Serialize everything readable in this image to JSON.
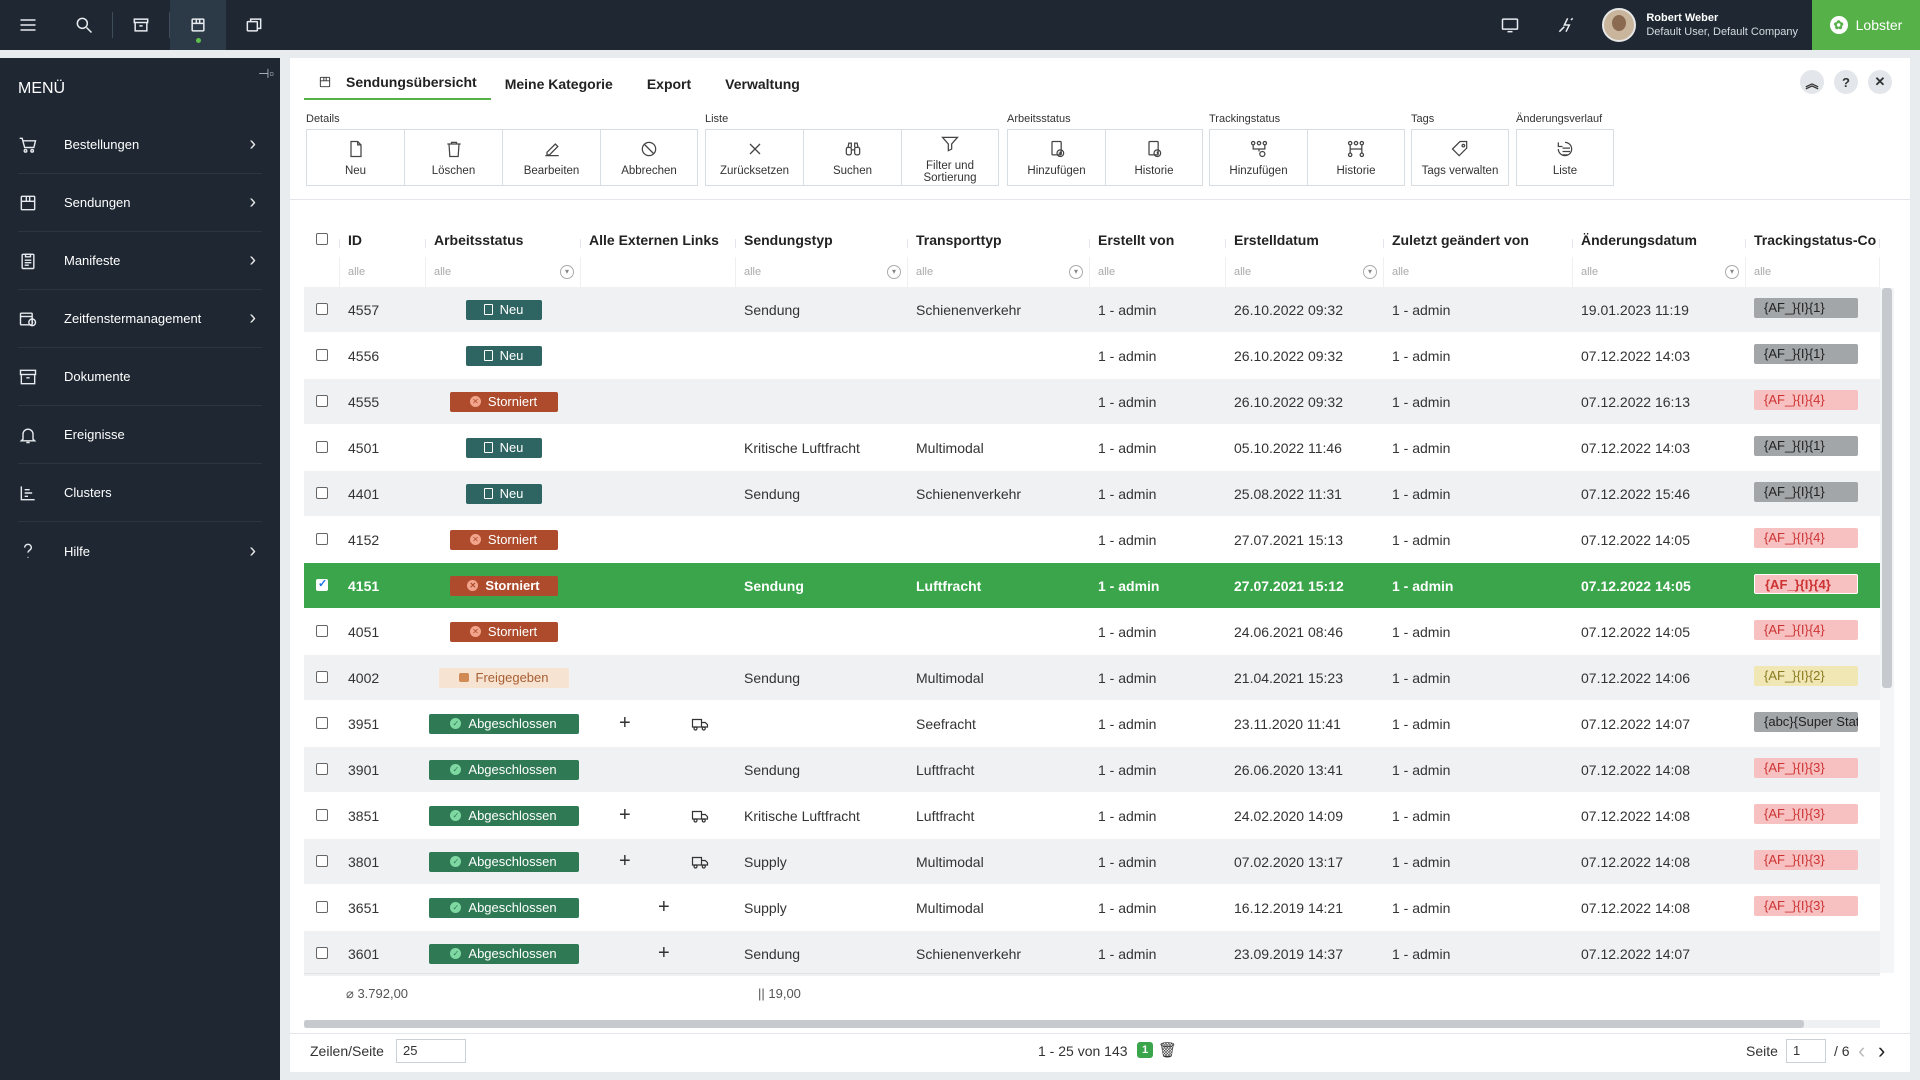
{
  "topbar": {
    "user_name": "Robert Weber",
    "user_sub": "Default User, Default Company",
    "brand": "Lobster"
  },
  "sidebar": {
    "title": "MENÜ",
    "items": [
      {
        "label": "Bestellungen",
        "icon": "cart-icon",
        "has_sub": true
      },
      {
        "label": "Sendungen",
        "icon": "package-icon",
        "has_sub": true
      },
      {
        "label": "Manifeste",
        "icon": "clipboard-icon",
        "has_sub": true
      },
      {
        "label": "Zeitfenstermanagement",
        "icon": "calendar-clock-icon",
        "has_sub": true
      },
      {
        "label": "Dokumente",
        "icon": "archive-icon",
        "has_sub": false
      },
      {
        "label": "Ereignisse",
        "icon": "bell-icon",
        "has_sub": false
      },
      {
        "label": "Clusters",
        "icon": "bars-icon",
        "has_sub": false
      },
      {
        "label": "Hilfe",
        "icon": "question-icon",
        "has_sub": true
      }
    ]
  },
  "tabs": [
    "Sendungsübersicht",
    "Meine Kategorie",
    "Export",
    "Verwaltung"
  ],
  "toolbar": {
    "details": {
      "label": "Details",
      "buttons": [
        "Neu",
        "Löschen",
        "Bearbeiten",
        "Abbrechen"
      ]
    },
    "liste": {
      "label": "Liste",
      "buttons": [
        "Zurücksetzen",
        "Suchen",
        "Filter und Sortierung"
      ]
    },
    "arbeitsstatus": {
      "label": "Arbeitsstatus",
      "buttons": [
        "Hinzufügen",
        "Historie"
      ]
    },
    "trackingstatus": {
      "label": "Trackingstatus",
      "buttons": [
        "Hinzufügen",
        "Historie"
      ]
    },
    "tags": {
      "label": "Tags",
      "buttons": [
        "Tags verwalten"
      ]
    },
    "aenderungsverlauf": {
      "label": "Änderungsverlauf",
      "buttons": [
        "Liste"
      ]
    }
  },
  "table": {
    "columns": [
      "ID",
      "Arbeitsstatus",
      "Alle Externen Links",
      "Sendungstyp",
      "Transporttyp",
      "Erstellt von",
      "Erstelldatum",
      "Zuletzt geändert von",
      "Änderungsdatum",
      "Trackingstatus-Co"
    ],
    "filter_placeholder": "alle",
    "rows": [
      {
        "id": "4557",
        "status": "Neu",
        "status_kind": "neu",
        "links": "",
        "sendungstyp": "Sendung",
        "transporttyp": "Schienenverkehr",
        "erstellt_von": "1 - admin",
        "erstelldatum": "26.10.2022 09:32",
        "geaendert_von": "1 - admin",
        "aenderungsdatum": "19.01.2023 11:19",
        "tracking": "{AF_}{I}{1}",
        "tracking_kind": "grey",
        "selected": false
      },
      {
        "id": "4556",
        "status": "Neu",
        "status_kind": "neu",
        "links": "",
        "sendungstyp": "",
        "transporttyp": "",
        "erstellt_von": "1 - admin",
        "erstelldatum": "26.10.2022 09:32",
        "geaendert_von": "1 - admin",
        "aenderungsdatum": "07.12.2022 14:03",
        "tracking": "{AF_}{I}{1}",
        "tracking_kind": "grey",
        "selected": false
      },
      {
        "id": "4555",
        "status": "Storniert",
        "status_kind": "sto",
        "links": "",
        "sendungstyp": "",
        "transporttyp": "",
        "erstellt_von": "1 - admin",
        "erstelldatum": "26.10.2022 09:32",
        "geaendert_von": "1 - admin",
        "aenderungsdatum": "07.12.2022 16:13",
        "tracking": "{AF_}{I}{4}",
        "tracking_kind": "red",
        "selected": false
      },
      {
        "id": "4501",
        "status": "Neu",
        "status_kind": "neu",
        "links": "",
        "sendungstyp": "Kritische Luftfracht",
        "transporttyp": "Multimodal",
        "erstellt_von": "1 - admin",
        "erstelldatum": "05.10.2022 11:46",
        "geaendert_von": "1 - admin",
        "aenderungsdatum": "07.12.2022 14:03",
        "tracking": "{AF_}{I}{1}",
        "tracking_kind": "grey",
        "selected": false
      },
      {
        "id": "4401",
        "status": "Neu",
        "status_kind": "neu",
        "links": "",
        "sendungstyp": "Sendung",
        "transporttyp": "Schienenverkehr",
        "erstellt_von": "1 - admin",
        "erstelldatum": "25.08.2022 11:31",
        "geaendert_von": "1 - admin",
        "aenderungsdatum": "07.12.2022 15:46",
        "tracking": "{AF_}{I}{1}",
        "tracking_kind": "grey",
        "selected": false
      },
      {
        "id": "4152",
        "status": "Storniert",
        "status_kind": "sto",
        "links": "",
        "sendungstyp": "",
        "transporttyp": "",
        "erstellt_von": "1 - admin",
        "erstelldatum": "27.07.2021 15:13",
        "geaendert_von": "1 - admin",
        "aenderungsdatum": "07.12.2022 14:05",
        "tracking": "{AF_}{I}{4}",
        "tracking_kind": "red",
        "selected": false
      },
      {
        "id": "4151",
        "status": "Storniert",
        "status_kind": "sto",
        "links": "",
        "sendungstyp": "Sendung",
        "transporttyp": "Luftfracht",
        "erstellt_von": "1 - admin",
        "erstelldatum": "27.07.2021 15:12",
        "geaendert_von": "1 - admin",
        "aenderungsdatum": "07.12.2022 14:05",
        "tracking": "{AF_}{I}{4}",
        "tracking_kind": "red",
        "selected": true
      },
      {
        "id": "4051",
        "status": "Storniert",
        "status_kind": "sto",
        "links": "",
        "sendungstyp": "",
        "transporttyp": "",
        "erstellt_von": "1 - admin",
        "erstelldatum": "24.06.2021 08:46",
        "geaendert_von": "1 - admin",
        "aenderungsdatum": "07.12.2022 14:05",
        "tracking": "{AF_}{I}{4}",
        "tracking_kind": "red",
        "selected": false
      },
      {
        "id": "4002",
        "status": "Freigegeben",
        "status_kind": "fre",
        "links": "",
        "sendungstyp": "Sendung",
        "transporttyp": "Multimodal",
        "erstellt_von": "1 - admin",
        "erstelldatum": "21.04.2021 15:23",
        "geaendert_von": "1 - admin",
        "aenderungsdatum": "07.12.2022 14:06",
        "tracking": "{AF_}{I}{2}",
        "tracking_kind": "yel",
        "selected": false
      },
      {
        "id": "3951",
        "status": "Abgeschlossen",
        "status_kind": "abg",
        "links": "plus-truck",
        "sendungstyp": "",
        "transporttyp": "Seefracht",
        "erstellt_von": "1 - admin",
        "erstelldatum": "23.11.2020 11:41",
        "geaendert_von": "1 - admin",
        "aenderungsdatum": "07.12.2022 14:07",
        "tracking": "{abc}{Super Status}",
        "tracking_kind": "grey",
        "selected": false
      },
      {
        "id": "3901",
        "status": "Abgeschlossen",
        "status_kind": "abg",
        "links": "",
        "sendungstyp": "Sendung",
        "transporttyp": "Luftfracht",
        "erstellt_von": "1 - admin",
        "erstelldatum": "26.06.2020 13:41",
        "geaendert_von": "1 - admin",
        "aenderungsdatum": "07.12.2022 14:08",
        "tracking": "{AF_}{I}{3}",
        "tracking_kind": "red",
        "selected": false
      },
      {
        "id": "3851",
        "status": "Abgeschlossen",
        "status_kind": "abg",
        "links": "plus-truck",
        "sendungstyp": "Kritische Luftfracht",
        "transporttyp": "Luftfracht",
        "erstellt_von": "1 - admin",
        "erstelldatum": "24.02.2020 14:09",
        "geaendert_von": "1 - admin",
        "aenderungsdatum": "07.12.2022 14:08",
        "tracking": "{AF_}{I}{3}",
        "tracking_kind": "red",
        "selected": false
      },
      {
        "id": "3801",
        "status": "Abgeschlossen",
        "status_kind": "abg",
        "links": "plus-truck",
        "sendungstyp": "Supply",
        "transporttyp": "Multimodal",
        "erstellt_von": "1 - admin",
        "erstelldatum": "07.02.2020 13:17",
        "geaendert_von": "1 - admin",
        "aenderungsdatum": "07.12.2022 14:08",
        "tracking": "{AF_}{I}{3}",
        "tracking_kind": "red",
        "selected": false
      },
      {
        "id": "3651",
        "status": "Abgeschlossen",
        "status_kind": "abg",
        "links": "plus",
        "sendungstyp": "Supply",
        "transporttyp": "Multimodal",
        "erstellt_von": "1 - admin",
        "erstelldatum": "16.12.2019 14:21",
        "geaendert_von": "1 - admin",
        "aenderungsdatum": "07.12.2022 14:08",
        "tracking": "{AF_}{I}{3}",
        "tracking_kind": "red",
        "selected": false
      },
      {
        "id": "3601",
        "status": "Abgeschlossen",
        "status_kind": "abg",
        "links": "plus",
        "sendungstyp": "Sendung",
        "transporttyp": "Schienenverkehr",
        "erstellt_von": "1 - admin",
        "erstelldatum": "23.09.2019 14:37",
        "geaendert_von": "1 - admin",
        "aenderungsdatum": "07.12.2022 14:07",
        "tracking": "",
        "tracking_kind": "",
        "selected": false
      }
    ],
    "summary_id": "⌀ 3.792,00",
    "summary_sendungstyp": "|| 19,00"
  },
  "footer": {
    "rows_label": "Zeilen/Seite",
    "rows_value": "25",
    "range": "1 - 25 von 143",
    "selected_count": "1",
    "page_label": "Seite",
    "page_value": "1",
    "page_total": "/ 6"
  }
}
